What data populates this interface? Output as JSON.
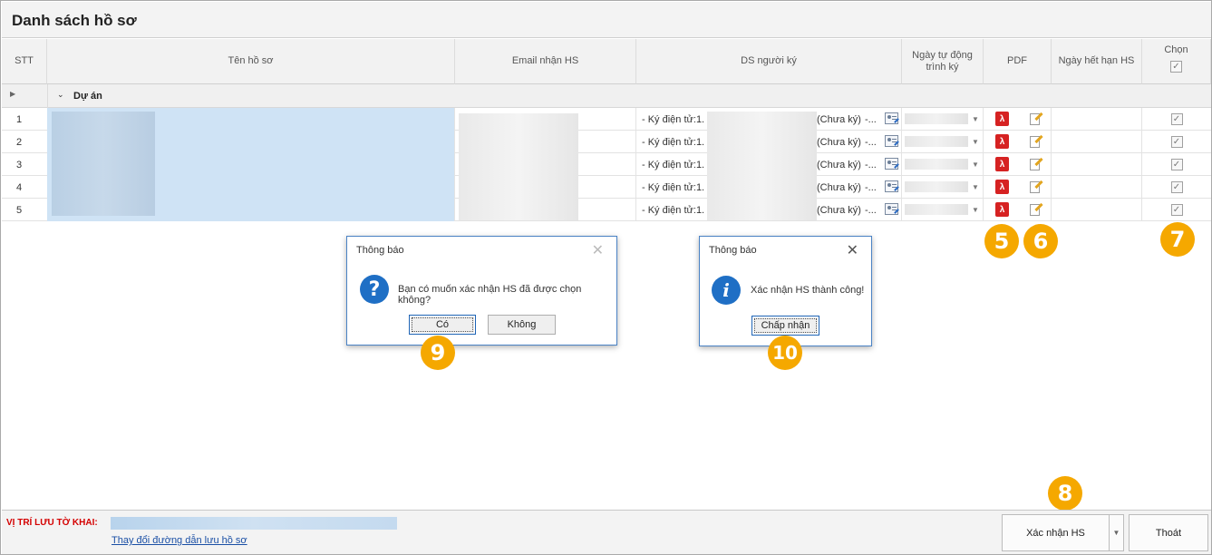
{
  "window": {
    "title": "Danh sách hồ sơ"
  },
  "table": {
    "headers": {
      "stt": "STT",
      "ten": "Tên hồ sơ",
      "email": "Email nhận HS",
      "ds": "DS người ký",
      "ngay_tu_dong": "Ngày tự động trình ký",
      "pdf": "PDF",
      "ngay_het_han": "Ngày hết hạn HS",
      "chon": "Chọn"
    },
    "group_label": "Dự án",
    "rows": [
      {
        "stt": "1",
        "ds_prefix": "- Ký điện tử:1.",
        "ds_status": "(Chưa ký)",
        "ds_more": "-..."
      },
      {
        "stt": "2",
        "ds_prefix": "- Ký điện tử:1.",
        "ds_status": "(Chưa ký)",
        "ds_more": "-..."
      },
      {
        "stt": "3",
        "ds_prefix": "- Ký điện tử:1.",
        "ds_status": "(Chưa ký)",
        "ds_more": "-..."
      },
      {
        "stt": "4",
        "ds_prefix": "- Ký điện tử:1.",
        "ds_status": "(Chưa ký)",
        "ds_more": "-..."
      },
      {
        "stt": "5",
        "ds_prefix": "- Ký điện tử:1.",
        "ds_status": "(Chưa ký)",
        "ds_more": "-..."
      }
    ]
  },
  "badges": {
    "b5": "5",
    "b6": "6",
    "b7": "7",
    "b8": "8",
    "b9": "9",
    "b10": "10"
  },
  "dialog_confirm": {
    "title": "Thông báo",
    "message": "Bạn có muốn xác nhận HS đã được chọn không?",
    "yes": "Có",
    "no": "Không"
  },
  "dialog_info": {
    "title": "Thông báo",
    "message": "Xác nhận HS thành công!",
    "ok": "Chấp nhận"
  },
  "footer": {
    "location_label": "VỊ TRÍ LƯU TỜ KHAI:",
    "change_link": "Thay đổi đường dẫn lưu hồ sơ",
    "confirm_button": "Xác nhận HS",
    "exit_button": "Thoát"
  },
  "colors": {
    "accent_badge": "#f5a800",
    "selected_row": "#cfe3f5",
    "label_red": "#d40000",
    "dialog_border": "#4a82c4"
  }
}
